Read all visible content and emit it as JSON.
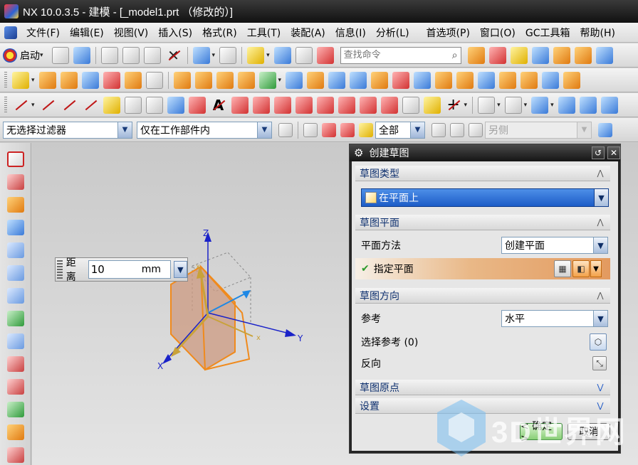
{
  "window": {
    "title": "NX 10.0.3.5 - 建模 - [_model1.prt （修改的）]"
  },
  "menubar": {
    "items": [
      "文件(F)",
      "编辑(E)",
      "视图(V)",
      "插入(S)",
      "格式(R)",
      "工具(T)",
      "装配(A)",
      "信息(I)",
      "分析(L)",
      "首选项(P)",
      "窗口(O)",
      "GC工具箱",
      "帮助(H)"
    ]
  },
  "toolbar": {
    "start_label": "启动",
    "search_placeholder": "查找命令"
  },
  "filterbar": {
    "selection_filter": "无选择过滤器",
    "scope": "仅在工作部件内",
    "snap_value": "全部",
    "disabled_combo": "另侧"
  },
  "distance_input": {
    "label": "距离",
    "value": "10",
    "unit": "mm"
  },
  "axes": {
    "x": "X",
    "y": "Y",
    "z": "Z"
  },
  "dialog": {
    "title": "创建草图",
    "sections": {
      "sketch_type": {
        "header": "草图类型",
        "selected": "在平面上"
      },
      "sketch_plane": {
        "header": "草图平面",
        "plane_method_label": "平面方法",
        "plane_method_value": "创建平面",
        "specify_plane_label": "指定平面"
      },
      "sketch_orientation": {
        "header": "草图方向",
        "reference_label": "参考",
        "reference_value": "水平",
        "select_reference_label": "选择参考 (0)",
        "reverse_label": "反向"
      },
      "sketch_origin": {
        "header": "草图原点"
      },
      "settings": {
        "header": "设置"
      }
    },
    "ok_label": "< 确定 >",
    "cancel_label": "取消"
  },
  "watermark": {
    "text": "3D世界网"
  },
  "colors": {
    "plane_orange": "#f08a1c",
    "axis_blue": "#1a22c8",
    "selection_blue": "#1c5cc7",
    "specify_plane_highlight": "#e39a5f"
  }
}
